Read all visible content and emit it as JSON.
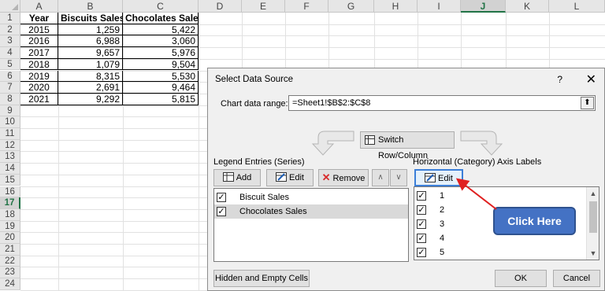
{
  "sheet": {
    "columns": [
      "A",
      "B",
      "C",
      "D",
      "E",
      "F",
      "G",
      "H",
      "I",
      "J",
      "K",
      "L"
    ],
    "active_column": "J",
    "rows": [
      "1",
      "2",
      "3",
      "4",
      "5",
      "6",
      "7",
      "8",
      "9",
      "10",
      "11",
      "12",
      "13",
      "14",
      "15",
      "16",
      "17",
      "18",
      "19",
      "20",
      "21",
      "22",
      "23",
      "24"
    ],
    "active_row": "17",
    "table": {
      "headers": [
        "Year",
        "Biscuits Sales",
        "Chocolates Sales"
      ],
      "data": [
        [
          "2015",
          "1,259",
          "5,422"
        ],
        [
          "2016",
          "6,988",
          "3,060"
        ],
        [
          "2017",
          "9,657",
          "5,976"
        ],
        [
          "2018",
          "1,079",
          "9,504"
        ],
        [
          "2019",
          "8,315",
          "5,530"
        ],
        [
          "2020",
          "2,691",
          "9,464"
        ],
        [
          "2021",
          "9,292",
          "5,815"
        ]
      ]
    }
  },
  "dialog": {
    "title": "Select Data Source",
    "help": "?",
    "close": "✕",
    "range_label": "Chart data range:",
    "range_value": "=Sheet1!$B$2:$C$8",
    "range_btn": "⬆",
    "switch_label": "Switch Row/Column",
    "legend_label": "Legend Entries (Series)",
    "legend_buttons": {
      "add": "Add",
      "edit": "Edit",
      "remove": "Remove",
      "up": "∧",
      "down": "∨"
    },
    "series": [
      "Biscuit Sales",
      "Chocolates Sales"
    ],
    "axis_label": "Horizontal (Category) Axis Labels",
    "axis_edit": "Edit",
    "categories": [
      "1",
      "2",
      "3",
      "4",
      "5"
    ],
    "hidden_cells_btn": "Hidden and Empty Cells",
    "ok_btn": "OK",
    "cancel_btn": "Cancel"
  },
  "callout": {
    "text": "Click Here"
  },
  "colors": {
    "callout": "#4472c4",
    "arrow": "#e02020",
    "excel_green": "#217346"
  }
}
